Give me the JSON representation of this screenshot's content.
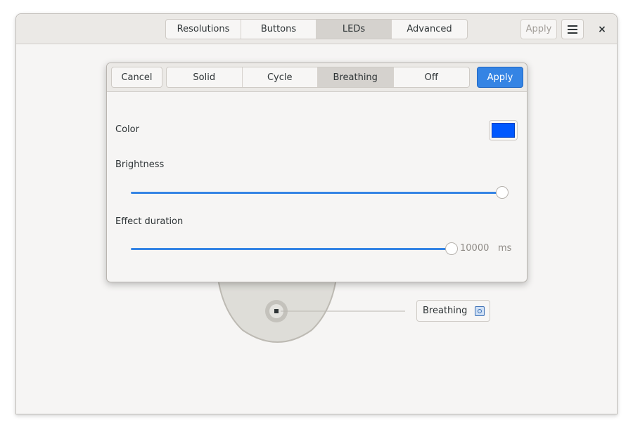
{
  "header": {
    "tabs": [
      {
        "label": "Resolutions",
        "active": false
      },
      {
        "label": "Buttons",
        "active": false
      },
      {
        "label": "LEDs",
        "active": true
      },
      {
        "label": "Advanced",
        "active": false
      }
    ],
    "apply_label": "Apply",
    "menu_icon": "hamburger-icon",
    "close_label": "×"
  },
  "popover": {
    "cancel_label": "Cancel",
    "modes": [
      {
        "label": "Solid",
        "active": false
      },
      {
        "label": "Cycle",
        "active": false
      },
      {
        "label": "Breathing",
        "active": true
      },
      {
        "label": "Off",
        "active": false
      }
    ],
    "apply_label": "Apply",
    "color_label": "Color",
    "color_value": "#0058ff",
    "brightness_label": "Brightness",
    "brightness_fraction": 1.0,
    "duration_label": "Effect duration",
    "duration_value": "10000",
    "duration_unit": "ms"
  },
  "led": {
    "mode_label": "Breathing"
  },
  "colors": {
    "accent": "#3584e4",
    "led_color": "#0058ff"
  }
}
